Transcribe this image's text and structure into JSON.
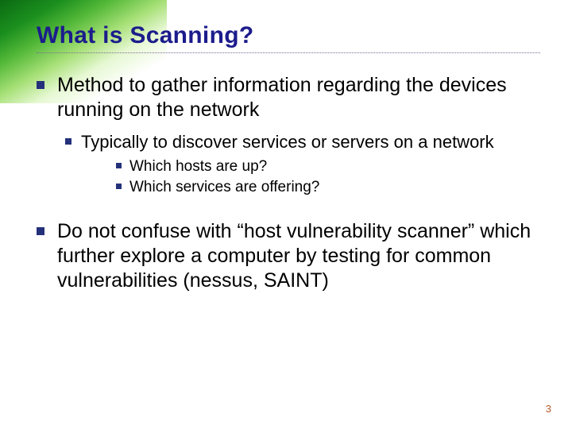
{
  "slide": {
    "title": "What is Scanning?",
    "bullets": [
      {
        "level": 1,
        "text": "Method to gather information regarding the devices running on the network",
        "children": [
          {
            "level": 2,
            "text": "Typically to discover services or servers on a network",
            "children": [
              {
                "level": 3,
                "text": "Which hosts are up?"
              },
              {
                "level": 3,
                "text": "Which services are offering?"
              }
            ]
          }
        ]
      },
      {
        "level": 1,
        "text": "Do not confuse with “host vulnerability scanner” which further explore a computer by testing for common vulnerabilities (nessus, SAINT)"
      }
    ],
    "page_number": "3"
  }
}
